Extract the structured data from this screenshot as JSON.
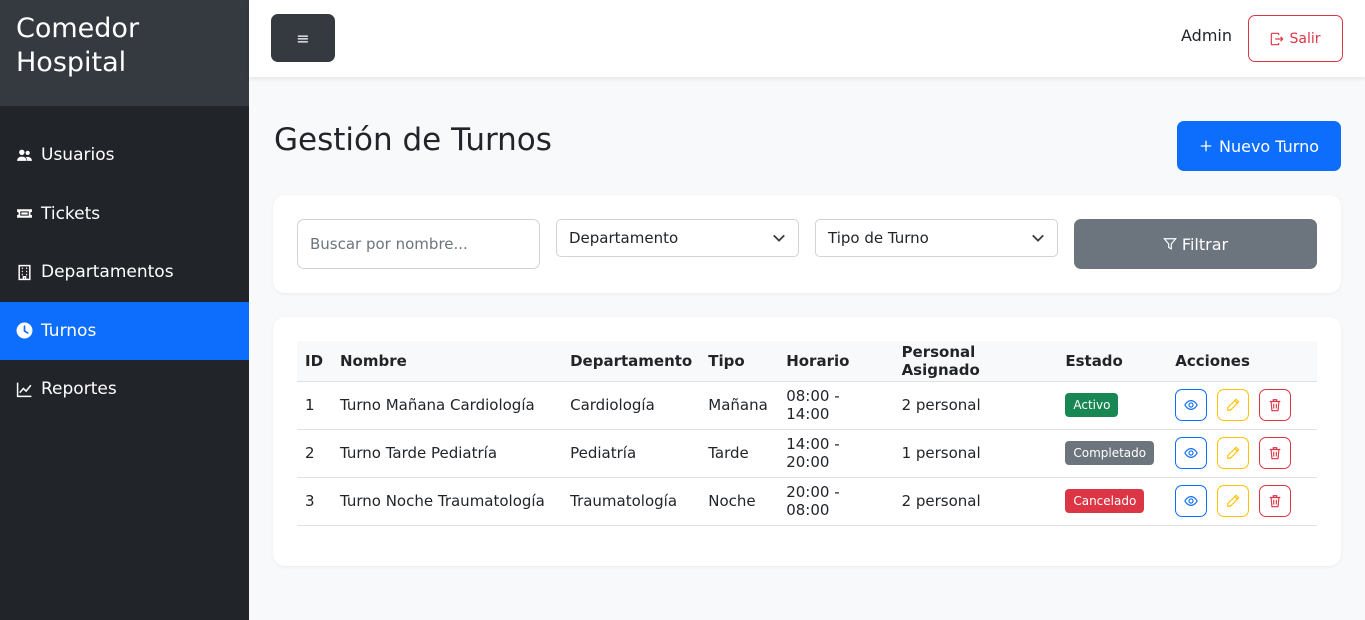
{
  "brand": {
    "title": "Comedor Hospital"
  },
  "sidebar": {
    "items": [
      {
        "label": "Usuarios",
        "icon": "users-icon",
        "active": false
      },
      {
        "label": "Tickets",
        "icon": "ticket-icon",
        "active": false
      },
      {
        "label": "Departamentos",
        "icon": "building-icon",
        "active": false
      },
      {
        "label": "Turnos",
        "icon": "clock-icon",
        "active": true
      },
      {
        "label": "Reportes",
        "icon": "chart-line-icon",
        "active": false
      }
    ]
  },
  "topbar": {
    "menu_label": "≡",
    "user_label": "Admin",
    "logout_label": "Salir"
  },
  "page": {
    "title": "Gestión de Turnos",
    "new_button_label": "Nuevo Turno"
  },
  "filters": {
    "search_placeholder": "Buscar por nombre...",
    "department_select": "Departamento",
    "shift_type_select": "Tipo de Turno",
    "filter_button_label": "Filtrar"
  },
  "table": {
    "headers": [
      "ID",
      "Nombre",
      "Departamento",
      "Tipo",
      "Horario",
      "Personal Asignado",
      "Estado",
      "Acciones"
    ],
    "rows": [
      {
        "id": "1",
        "name": "Turno Mañana Cardiología",
        "department": "Cardiología",
        "type": "Mañana",
        "schedule": "08:00 - 14:00",
        "staff": "2 personal",
        "status": "Activo",
        "status_color": "#198754"
      },
      {
        "id": "2",
        "name": "Turno Tarde Pediatría",
        "department": "Pediatría",
        "type": "Tarde",
        "schedule": "14:00 - 20:00",
        "staff": "1 personal",
        "status": "Completado",
        "status_color": "#6c757d"
      },
      {
        "id": "3",
        "name": "Turno Noche Traumatología",
        "department": "Traumatología",
        "type": "Noche",
        "schedule": "20:00 - 08:00",
        "staff": "2 personal",
        "status": "Cancelado",
        "status_color": "#dc3545"
      }
    ]
  },
  "colors": {
    "primary": "#0d6efd",
    "sidebar_bg": "#212529",
    "brand_bg": "#343a40",
    "danger": "#dc3545",
    "warning": "#ffc107",
    "secondary": "#6c757d",
    "success": "#198754"
  }
}
